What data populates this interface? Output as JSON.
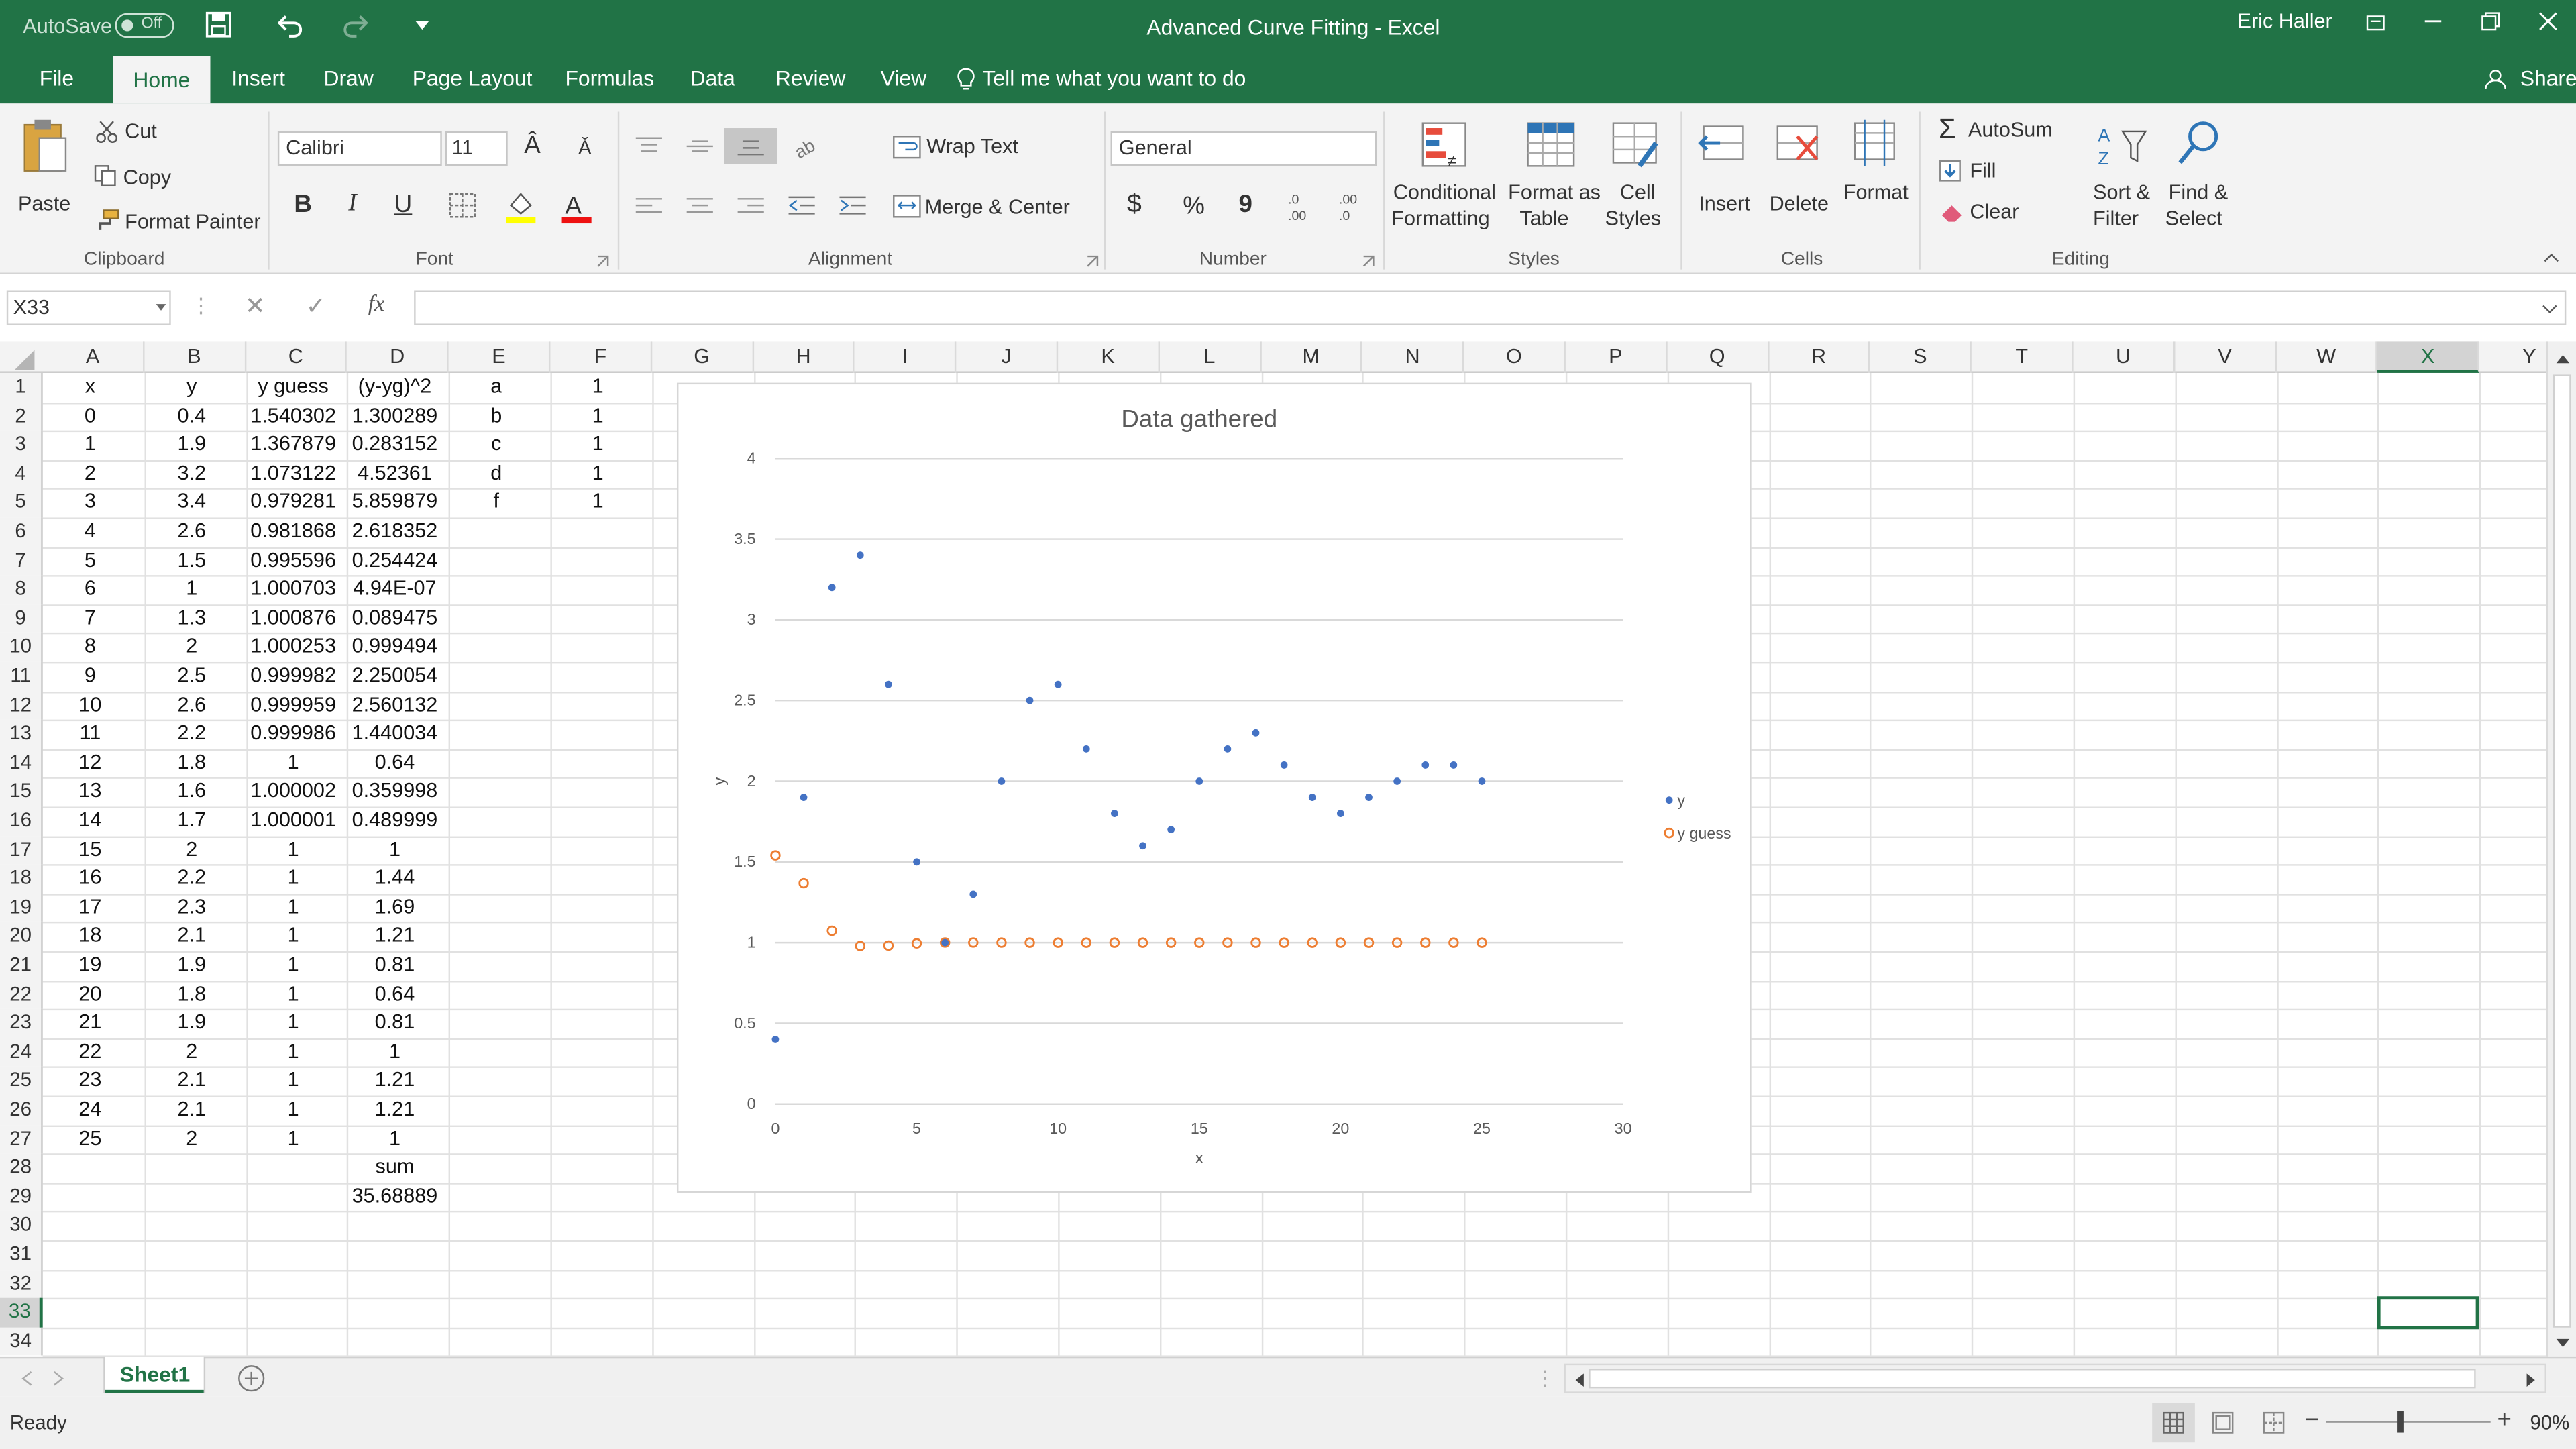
{
  "titlebar": {
    "autosave_label": "AutoSave",
    "autosave_state": "Off",
    "title": "Advanced Curve Fitting  -  Excel",
    "user": "Eric Haller"
  },
  "tabs": [
    "File",
    "Home",
    "Insert",
    "Draw",
    "Page Layout",
    "Formulas",
    "Data",
    "Review",
    "View"
  ],
  "tell_me": "Tell me what you want to do",
  "share": "Share",
  "ribbon": {
    "paste": "Paste",
    "cut": "Cut",
    "copy": "Copy",
    "format_painter": "Format Painter",
    "clipboard": "Clipboard",
    "font_name": "Calibri",
    "font_size": "11",
    "font": "Font",
    "bold": "B",
    "italic": "I",
    "underline": "U",
    "wrap_text": "Wrap Text",
    "merge_center": "Merge & Center",
    "alignment": "Alignment",
    "number_format": "General",
    "currency": "$",
    "percent": "%",
    "comma": "9",
    "number": "Number",
    "cond_fmt_1": "Conditional",
    "cond_fmt_2": "Formatting",
    "fmt_table_1": "Format as",
    "fmt_table_2": "Table",
    "cell_styles_1": "Cell",
    "cell_styles_2": "Styles",
    "styles": "Styles",
    "insert": "Insert",
    "delete": "Delete",
    "format": "Format",
    "cells": "Cells",
    "autosum": "AutoSum",
    "fill": "Fill",
    "clear": "Clear",
    "sort_1": "Sort &",
    "sort_2": "Filter",
    "find_1": "Find &",
    "find_2": "Select",
    "editing": "Editing"
  },
  "formula_bar": {
    "name_box": "X33",
    "fx": "fx",
    "content": ""
  },
  "columns": [
    "A",
    "B",
    "C",
    "D",
    "E",
    "F",
    "G",
    "H",
    "I",
    "J",
    "K",
    "L",
    "M",
    "N",
    "O",
    "P",
    "Q",
    "R",
    "S",
    "T",
    "U",
    "V",
    "W",
    "X",
    "Y"
  ],
  "rows": [
    "1",
    "2",
    "3",
    "4",
    "5",
    "6",
    "7",
    "8",
    "9",
    "10",
    "11",
    "12",
    "13",
    "14",
    "15",
    "16",
    "17",
    "18",
    "19",
    "20",
    "21",
    "22",
    "23",
    "24",
    "25",
    "26",
    "27",
    "28",
    "29",
    "30",
    "31",
    "32",
    "33",
    "34"
  ],
  "cells": {
    "A": [
      "x",
      "0",
      "1",
      "2",
      "3",
      "4",
      "5",
      "6",
      "7",
      "8",
      "9",
      "10",
      "11",
      "12",
      "13",
      "14",
      "15",
      "16",
      "17",
      "18",
      "19",
      "20",
      "21",
      "22",
      "23",
      "24",
      "25"
    ],
    "B": [
      "y",
      "0.4",
      "1.9",
      "3.2",
      "3.4",
      "2.6",
      "1.5",
      "1",
      "1.3",
      "2",
      "2.5",
      "2.6",
      "2.2",
      "1.8",
      "1.6",
      "1.7",
      "2",
      "2.2",
      "2.3",
      "2.1",
      "1.9",
      "1.8",
      "1.9",
      "2",
      "2.1",
      "2.1",
      "2"
    ],
    "C": [
      "y guess",
      "1.540302",
      "1.367879",
      "1.073122",
      "0.979281",
      "0.981868",
      "0.995596",
      "1.000703",
      "1.000876",
      "1.000253",
      "0.999982",
      "0.999959",
      "0.999986",
      "1",
      "1.000002",
      "1.000001",
      "1",
      "1",
      "1",
      "1",
      "1",
      "1",
      "1",
      "1",
      "1",
      "1",
      "1"
    ],
    "D": [
      "(y-yg)^2",
      "1.300289",
      "0.283152",
      "4.52361",
      "5.859879",
      "2.618352",
      "0.254424",
      "4.94E-07",
      "0.089475",
      "0.999494",
      "2.250054",
      "2.560132",
      "1.440034",
      "0.64",
      "0.359998",
      "0.489999",
      "1",
      "1.44",
      "1.69",
      "1.21",
      "0.81",
      "0.64",
      "0.81",
      "1",
      "1.21",
      "1.21",
      "1",
      "sum",
      "35.68889"
    ],
    "E": [
      "a",
      "b",
      "c",
      "d",
      "f"
    ],
    "F": [
      "1",
      "1",
      "1",
      "1",
      "1"
    ]
  },
  "chart_data": {
    "type": "scatter",
    "title": "Data gathered",
    "xlabel": "x",
    "ylabel": "y",
    "xlim": [
      0,
      30
    ],
    "ylim": [
      0,
      4
    ],
    "xticks": [
      "0",
      "5",
      "10",
      "15",
      "20",
      "25",
      "30"
    ],
    "yticks": [
      "0",
      "0.5",
      "1",
      "1.5",
      "2",
      "2.5",
      "3",
      "3.5",
      "4"
    ],
    "grid": "horizontal",
    "legend_position": "right",
    "series": [
      {
        "name": "y",
        "color": "#4472c4",
        "marker": "filled",
        "x": [
          0,
          1,
          2,
          3,
          4,
          5,
          6,
          7,
          8,
          9,
          10,
          11,
          12,
          13,
          14,
          15,
          16,
          17,
          18,
          19,
          20,
          21,
          22,
          23,
          24,
          25
        ],
        "y": [
          0.4,
          1.9,
          3.2,
          3.4,
          2.6,
          1.5,
          1,
          1.3,
          2,
          2.5,
          2.6,
          2.2,
          1.8,
          1.6,
          1.7,
          2,
          2.2,
          2.3,
          2.1,
          1.9,
          1.8,
          1.9,
          2,
          2.1,
          2.1,
          2
        ]
      },
      {
        "name": "y guess",
        "color": "#ed7d31",
        "marker": "hollow",
        "x": [
          0,
          1,
          2,
          3,
          4,
          5,
          6,
          7,
          8,
          9,
          10,
          11,
          12,
          13,
          14,
          15,
          16,
          17,
          18,
          19,
          20,
          21,
          22,
          23,
          24,
          25
        ],
        "y": [
          1.540302,
          1.367879,
          1.073122,
          0.979281,
          0.981868,
          0.995596,
          1.000703,
          1.000876,
          1.000253,
          0.999982,
          0.999959,
          0.999986,
          1,
          1.000002,
          1.000001,
          1,
          1,
          1,
          1,
          1,
          1,
          1,
          1,
          1,
          1,
          1
        ]
      }
    ]
  },
  "sheet_tab": "Sheet1",
  "status": {
    "ready": "Ready",
    "zoom": "90%"
  },
  "colors": {
    "excel_green": "#217346",
    "selection": "#217346"
  }
}
